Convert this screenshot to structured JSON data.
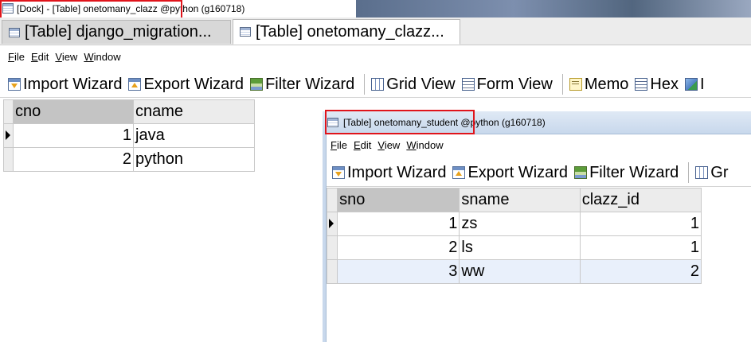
{
  "window_title": "[Dock] - [Table] onetomany_clazz @python (g160718)",
  "doc_tabs": [
    {
      "label": "[Table] django_migration...",
      "active": false
    },
    {
      "label": "[Table] onetomany_clazz...",
      "active": true
    }
  ],
  "menu": [
    "File",
    "Edit",
    "View",
    "Window"
  ],
  "main_toolbar": {
    "import": "Import Wizard",
    "export": "Export Wizard",
    "filter": "Filter Wizard",
    "grid_view": "Grid View",
    "form_view": "Form View",
    "memo": "Memo",
    "hex": "Hex",
    "image": "I"
  },
  "clazz_table": {
    "columns": [
      "cno",
      "cname"
    ],
    "rows": [
      {
        "cno": "1",
        "cname": "java"
      },
      {
        "cno": "2",
        "cname": "python"
      }
    ]
  },
  "student_window": {
    "title": "[Table] onetomany_student @python (g160718)",
    "menu": [
      "File",
      "Edit",
      "View",
      "Window"
    ],
    "toolbar": {
      "import": "Import Wizard",
      "export": "Export Wizard",
      "filter": "Filter Wizard",
      "grid": "Gr"
    },
    "table": {
      "columns": [
        "sno",
        "sname",
        "clazz_id"
      ],
      "rows": [
        {
          "sno": "1",
          "sname": "zs",
          "clazz_id": "1"
        },
        {
          "sno": "2",
          "sname": "ls",
          "clazz_id": "1"
        },
        {
          "sno": "3",
          "sname": "ww",
          "clazz_id": "2"
        }
      ]
    }
  },
  "colors": {
    "highlight_box": "#e0141b",
    "selected_row": "#e9f0fb",
    "sorted_header": "#c4c4c4"
  }
}
